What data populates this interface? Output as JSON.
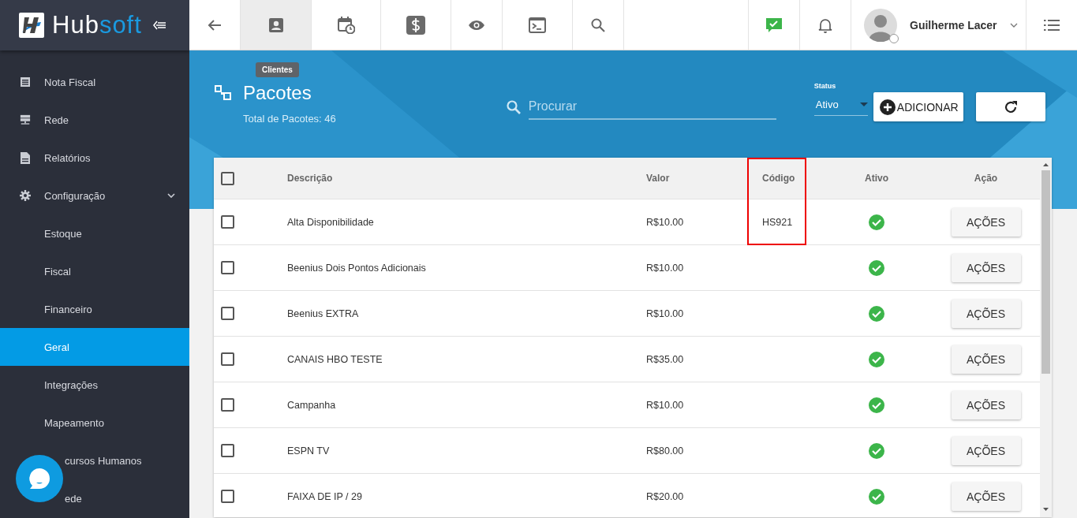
{
  "logo": {
    "first": "Hub",
    "second": "soft"
  },
  "sidebar": {
    "items": [
      {
        "label": "Nota Fiscal"
      },
      {
        "label": "Rede"
      },
      {
        "label": "Relatórios"
      },
      {
        "label": "Configuração",
        "expanded": true,
        "children": [
          {
            "label": "Estoque",
            "selected": false
          },
          {
            "label": "Fiscal",
            "selected": false
          },
          {
            "label": "Financeiro",
            "selected": false
          },
          {
            "label": "Geral",
            "selected": true
          },
          {
            "label": "Integrações",
            "selected": false
          },
          {
            "label": "Mapeamento",
            "selected": false
          },
          {
            "label": "cursos Humanos",
            "selected": false,
            "kind": "partial"
          },
          {
            "label": "ede",
            "selected": false,
            "kind": "partial"
          }
        ]
      }
    ]
  },
  "toolbar": {
    "tabs": [
      {
        "kind": "back",
        "selected": false
      },
      {
        "kind": "clients",
        "selected": true
      },
      {
        "kind": "calendar",
        "selected": false
      },
      {
        "kind": "money",
        "selected": false
      },
      {
        "kind": "eye",
        "selected": false
      },
      {
        "kind": "terminal",
        "selected": false
      },
      {
        "kind": "search",
        "selected": false
      }
    ],
    "tooltip": "Clientes",
    "user": {
      "name": "Guilherme Lacer"
    }
  },
  "header": {
    "title": "Pacotes",
    "subtitle": "Total de Pacotes: 46",
    "search": {
      "placeholder": "Procurar"
    },
    "status": {
      "label": "Status",
      "value": "Ativo"
    },
    "add_button": "ADICIONAR"
  },
  "table": {
    "select_all_checked": false,
    "columns": [
      {
        "label": "Descrição",
        "highlighted": false
      },
      {
        "label": "Valor",
        "highlighted": false
      },
      {
        "label": "Código",
        "highlighted": true
      },
      {
        "label": "Ativo",
        "highlighted": false
      },
      {
        "label": "Ação",
        "highlighted": false
      }
    ],
    "rows": [
      {
        "checked": false,
        "description": "Alta Disponibilidade",
        "value": "R$10.00",
        "code": "HS921",
        "active": true,
        "action": "AÇÕES"
      },
      {
        "checked": false,
        "description": "Beenius Dois Pontos Adicionais",
        "value": "R$10.00",
        "active": true,
        "action": "AÇÕES"
      },
      {
        "checked": false,
        "description": "Beenius EXTRA",
        "value": "R$10.00",
        "active": true,
        "action": "AÇÕES"
      },
      {
        "checked": false,
        "description": "CANAIS HBO TESTE",
        "value": "R$35.00",
        "active": true,
        "action": "AÇÕES"
      },
      {
        "checked": false,
        "description": "Campanha",
        "value": "R$10.00",
        "active": true,
        "action": "AÇÕES"
      },
      {
        "checked": false,
        "description": "ESPN TV",
        "value": "R$80.00",
        "active": true,
        "action": "AÇÕES"
      },
      {
        "checked": false,
        "description": "FAIXA DE IP / 29",
        "value": "R$20.00",
        "active": true,
        "action": "AÇÕES"
      }
    ]
  }
}
